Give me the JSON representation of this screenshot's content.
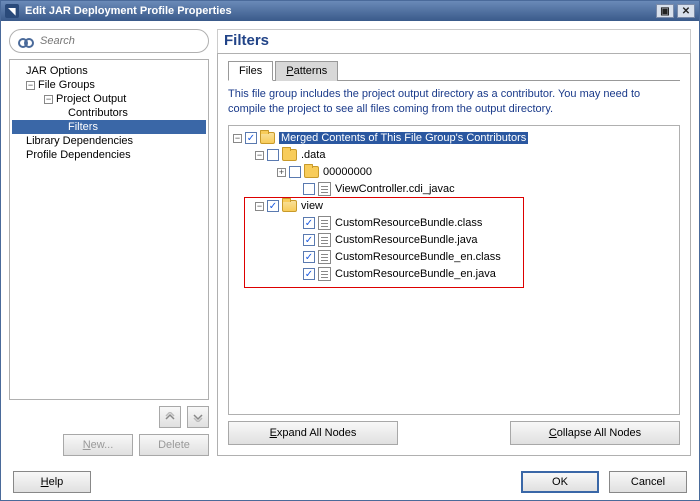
{
  "window": {
    "title": "Edit JAR Deployment Profile Properties"
  },
  "search": {
    "placeholder": "Search"
  },
  "nav": {
    "items": [
      {
        "label": "JAR Options",
        "indent": 12,
        "toggle": "",
        "selected": false
      },
      {
        "label": "File Groups",
        "indent": 12,
        "toggle": "−",
        "selected": false
      },
      {
        "label": "Project Output",
        "indent": 30,
        "toggle": "−",
        "selected": false
      },
      {
        "label": "Contributors",
        "indent": 54,
        "toggle": "",
        "selected": false
      },
      {
        "label": "Filters",
        "indent": 54,
        "toggle": "",
        "selected": true
      },
      {
        "label": "Library Dependencies",
        "indent": 12,
        "toggle": "",
        "selected": false
      },
      {
        "label": "Profile Dependencies",
        "indent": 12,
        "toggle": "",
        "selected": false
      }
    ],
    "new_btn": "New...",
    "delete_btn": "Delete"
  },
  "panel": {
    "title": "Filters",
    "tabs": {
      "files": "Files",
      "patterns": "Patterns",
      "active": 0
    },
    "info": "This file group includes the project output directory as a contributor.  You may need to compile the project to see all files coming from the output directory.",
    "tree": [
      {
        "indent": 0,
        "toggle": "−",
        "checked": true,
        "icon": "folder-open",
        "label": "Merged Contents of This File Group's Contributors",
        "selected": true
      },
      {
        "indent": 22,
        "toggle": "−",
        "checked": false,
        "icon": "folder",
        "label": ".data"
      },
      {
        "indent": 44,
        "toggle": "+",
        "checked": false,
        "icon": "folder",
        "label": "00000000"
      },
      {
        "indent": 58,
        "toggle": "",
        "checked": false,
        "icon": "file",
        "label": "ViewController.cdi_javac"
      },
      {
        "indent": 22,
        "toggle": "−",
        "checked": true,
        "icon": "folder-open",
        "label": "view"
      },
      {
        "indent": 58,
        "toggle": "",
        "checked": true,
        "icon": "file",
        "label": "CustomResourceBundle.class"
      },
      {
        "indent": 58,
        "toggle": "",
        "checked": true,
        "icon": "file",
        "label": "CustomResourceBundle.java"
      },
      {
        "indent": 58,
        "toggle": "",
        "checked": true,
        "icon": "file",
        "label": "CustomResourceBundle_en.class"
      },
      {
        "indent": 58,
        "toggle": "",
        "checked": true,
        "icon": "file",
        "label": "CustomResourceBundle_en.java"
      }
    ],
    "expand": "Expand All Nodes",
    "collapse": "Collapse All Nodes"
  },
  "footer": {
    "help": "Help",
    "ok": "OK",
    "cancel": "Cancel"
  }
}
